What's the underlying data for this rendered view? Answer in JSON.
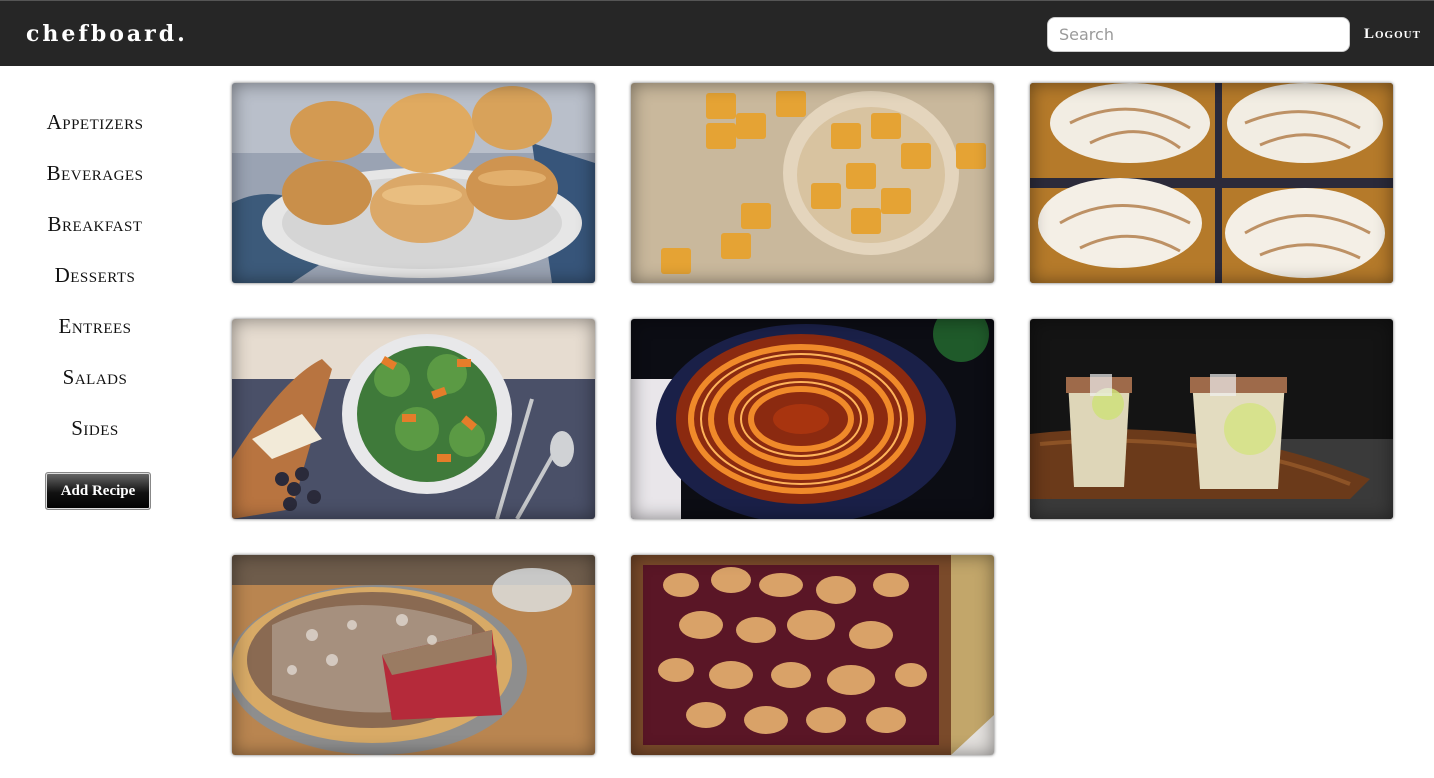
{
  "header": {
    "brand": "chefboard.",
    "search_placeholder": "Search",
    "search_value": "",
    "logout_label": "Logout"
  },
  "sidebar": {
    "categories": [
      {
        "label": "Appetizers"
      },
      {
        "label": "Beverages"
      },
      {
        "label": "Breakfast"
      },
      {
        "label": "Desserts"
      },
      {
        "label": "Entrees"
      },
      {
        "label": "Salads"
      },
      {
        "label": "Sides"
      }
    ],
    "add_recipe_label": "Add Recipe"
  },
  "recipes": [
    {
      "image": "biscuits-photo"
    },
    {
      "image": "cheese-crackers-photo"
    },
    {
      "image": "meringue-bars-photo"
    },
    {
      "image": "squash-salad-photo"
    },
    {
      "image": "sweet-potato-gratin-photo"
    },
    {
      "image": "margarita-drinks-photo"
    },
    {
      "image": "crumb-pie-photo"
    },
    {
      "image": "berry-cobbler-photo"
    }
  ]
}
